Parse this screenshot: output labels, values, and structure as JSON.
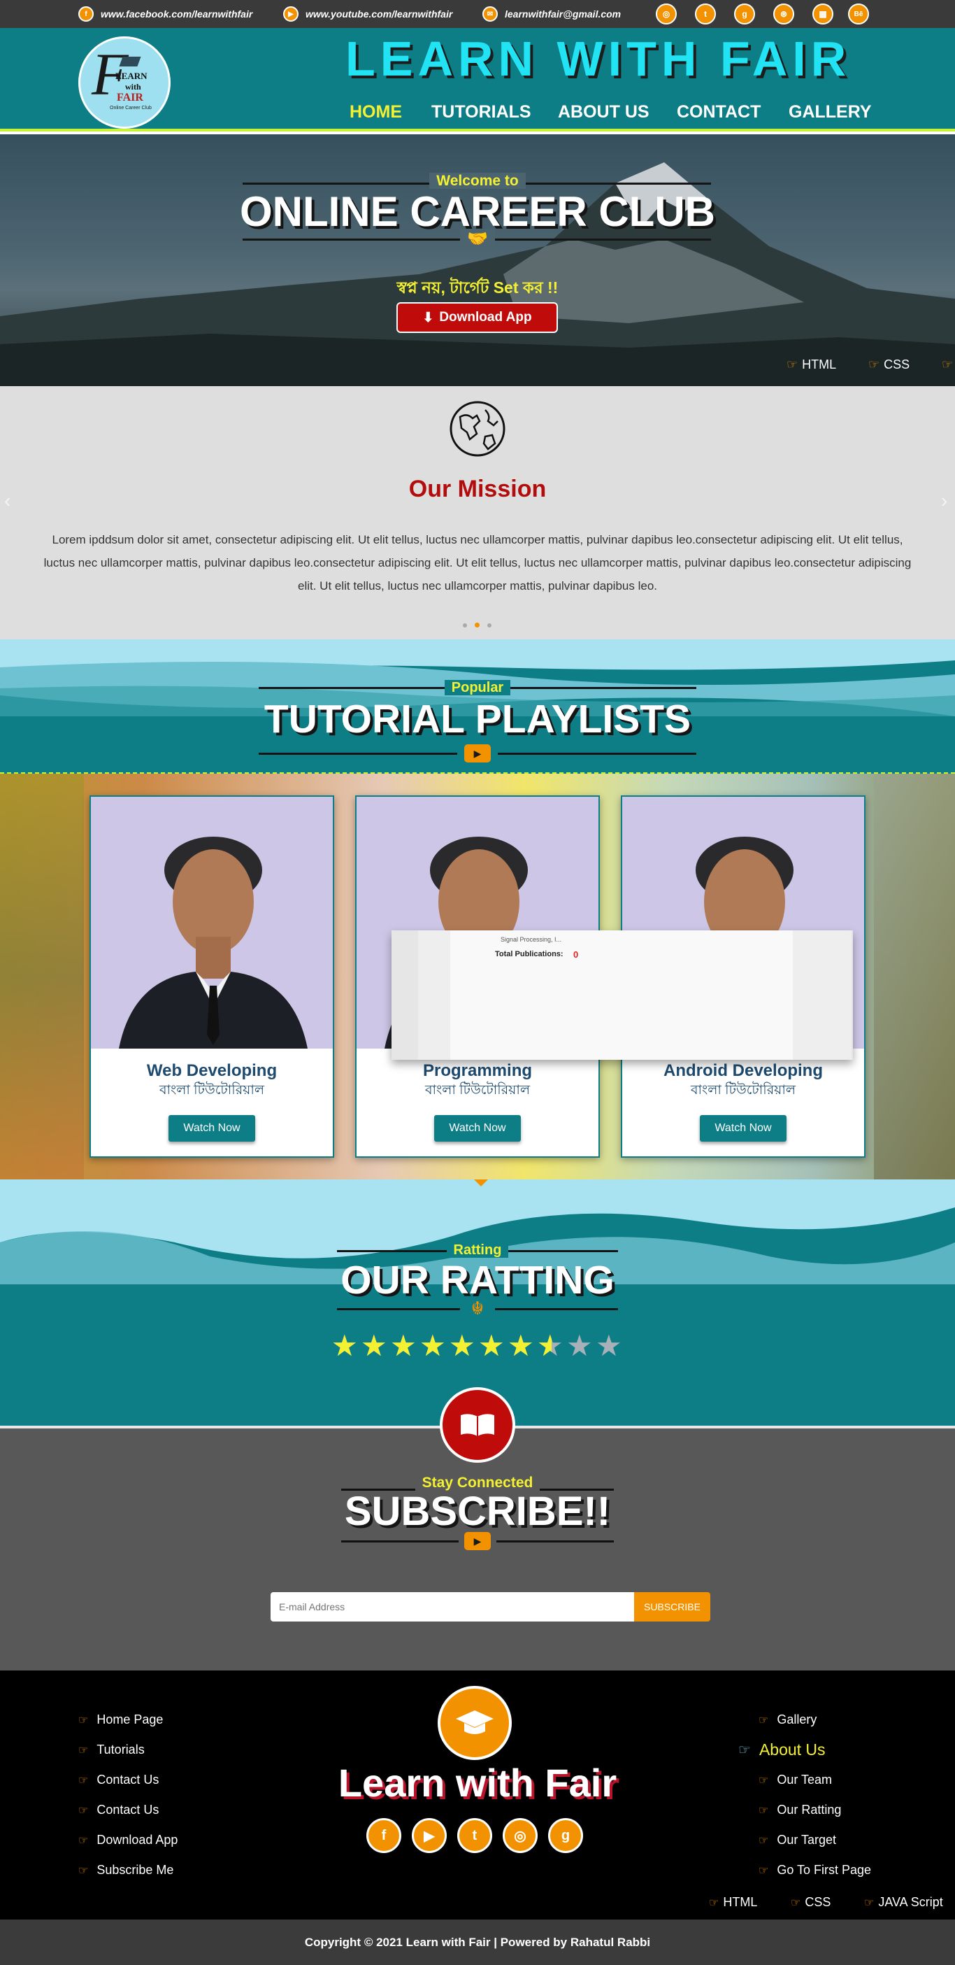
{
  "topbar": {
    "facebook": "www.facebook.com/learnwithfair",
    "youtube": "www.youtube.com/learnwithfair",
    "email": "learnwithfair@gmail.com",
    "social_icons": [
      "instagram-icon",
      "twitter-icon",
      "github-icon",
      "dribbble-icon",
      "calendar-icon",
      "behance-icon"
    ]
  },
  "header": {
    "logo": {
      "letter": "F",
      "line1": "LEARN",
      "line2": "with",
      "line3": "FAIR",
      "tagline": "Online Career Club"
    },
    "brand": "LEARN WITH FAIR",
    "nav": [
      "HOME",
      "TUTORIALS",
      "ABOUT US",
      "CONTACT",
      "GALLERY"
    ],
    "active": "HOME"
  },
  "hero": {
    "kicker": "Welcome to",
    "title": "ONLINE CAREER CLUB",
    "tagline": "স্বপ্ন নয়, টার্গেট Set কর !!",
    "download": "Download App",
    "ticker": [
      "HTML",
      "CSS"
    ]
  },
  "mission": {
    "title": "Our Mission",
    "text": "Lorem ipddsum dolor sit amet, consectetur adipiscing elit. Ut elit tellus, luctus nec ullamcorper mattis, pulvinar dapibus leo.consectetur adipiscing elit. Ut elit tellus, luctus nec ullamcorper mattis, pulvinar dapibus leo.consectetur adipiscing elit. Ut elit tellus, luctus nec ullamcorper mattis, pulvinar dapibus leo.consectetur adipiscing elit. Ut elit tellus, luctus nec ullamcorper mattis, pulvinar dapibus leo.",
    "slides": 3,
    "active_slide": 2
  },
  "playlists": {
    "kicker": "Popular",
    "title": "TUTORIAL PLAYLISTS",
    "cards": [
      {
        "title": "Web Developing",
        "sub": "বাংলা টিউটোরিয়াল",
        "button": "Watch Now"
      },
      {
        "title": "Programming",
        "sub": "বাংলা টিউটোরিয়াল",
        "button": "Watch Now"
      },
      {
        "title": "Android Developing",
        "sub": "বাংলা টিউটোরিয়াল",
        "button": "Watch Now"
      }
    ],
    "popup": {
      "line1": "Signal Processing, I...",
      "label": "Total Publications:",
      "value": "0"
    }
  },
  "rating": {
    "kicker": "Ratting",
    "title": "OUR RATTING",
    "stars_total": 10,
    "stars_value": 7.5
  },
  "subscribe": {
    "kicker": "Stay Connected",
    "title": "SUBSCRIBE!!",
    "placeholder": "E-mail Address",
    "button": "SUBSCRIBE"
  },
  "footer": {
    "left_links": [
      "Home Page",
      "Tutorials",
      "Contact Us",
      "Contact Us",
      "Download App",
      "Subscribe Me"
    ],
    "brand": "Learn with Fair",
    "right_links": [
      "Gallery",
      "About Us",
      "Our Team",
      "Our Ratting",
      "Our Target",
      "Go To First Page"
    ],
    "right_highlight": "About Us",
    "ticker": [
      "HTML",
      "CSS",
      "JAVA Script"
    ],
    "copyright": "Copyright © 2021 Learn with Fair | Powered by Rahatul Rabbi"
  },
  "colors": {
    "teal": "#0e7e86",
    "orange": "#f39200",
    "yellow": "#f4f032",
    "lime": "#c8f233",
    "red": "#c00b0b",
    "cyan": "#22e3f3"
  }
}
